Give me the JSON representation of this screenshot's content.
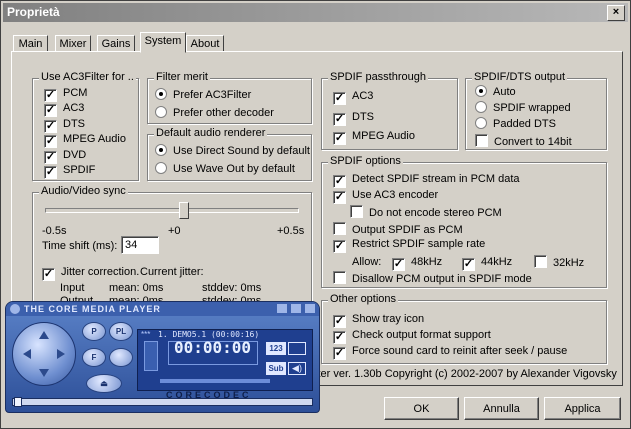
{
  "window": {
    "title": "Proprietà",
    "close": "×"
  },
  "tabs": [
    {
      "label": "Main"
    },
    {
      "label": "Mixer"
    },
    {
      "label": "Gains"
    },
    {
      "label": "System"
    },
    {
      "label": "About"
    }
  ],
  "use_ac3filter": {
    "title": "Use AC3Filter for ..",
    "items": [
      {
        "label": "PCM"
      },
      {
        "label": "AC3"
      },
      {
        "label": "DTS"
      },
      {
        "label": "MPEG Audio"
      },
      {
        "label": "DVD"
      },
      {
        "label": "SPDIF"
      }
    ]
  },
  "filter_merit": {
    "title": "Filter merit",
    "prefer_ac3": "Prefer AC3Filter",
    "prefer_other": "Prefer other decoder"
  },
  "default_renderer": {
    "title": "Default audio renderer",
    "direct_sound": "Use Direct Sound by default",
    "wave_out": "Use Wave Out by default"
  },
  "av_sync": {
    "title": "Audio/Video sync",
    "min": "-0.5s",
    "mid": "+0",
    "max": "+0.5s",
    "time_shift_label": "Time shift (ms):",
    "time_shift_value": "34",
    "jitter_label": "Jitter correction.",
    "current_jitter": "Current jitter:",
    "input": "Input",
    "output": "Output",
    "mean": "mean: 0ms",
    "stddev": "stddev: 0ms"
  },
  "spdif_pass": {
    "title": "SPDIF passthrough",
    "items": [
      {
        "label": "AC3"
      },
      {
        "label": "DTS"
      },
      {
        "label": "MPEG Audio"
      }
    ]
  },
  "spdif_dts": {
    "title": "SPDIF/DTS output",
    "auto": "Auto",
    "wrapped": "SPDIF wrapped",
    "padded": "Padded DTS",
    "convert14": "Convert to 14bit"
  },
  "spdif_options": {
    "title": "SPDIF options",
    "detect": "Detect SPDIF stream in PCM data",
    "use_ac3_encoder": "Use AC3 encoder",
    "no_stereo_pcm": "Do not encode stereo PCM",
    "output_pcm": "Output SPDIF as PCM",
    "restrict": "Restrict SPDIF sample rate",
    "allow": "Allow:",
    "r48": "48kHz",
    "r44": "44kHz",
    "r32": "32kHz",
    "disallow_pcm": "Disallow PCM output in SPDIF mode"
  },
  "other_options": {
    "title": "Other options",
    "tray": "Show tray icon",
    "check": "Check output format support",
    "force": "Force sound card to reinit after seek / pause"
  },
  "version": "lter ver. 1.30b Copyright (c) 2002-2007 by Alexander Vigovsky",
  "buttons": {
    "ok": "OK",
    "cancel": "Annulla",
    "apply": "Applica"
  },
  "player": {
    "title": "THE CORE MEDIA PLAYER",
    "track": "1. DEMO5.1  (00:00:16)",
    "time": "00:00:00",
    "brand": "CORECODEC",
    "stars": "***",
    "btn123": "123",
    "sub": "Sub",
    "pl": "PL",
    "btn_p": "P",
    "btn_f": "F"
  }
}
